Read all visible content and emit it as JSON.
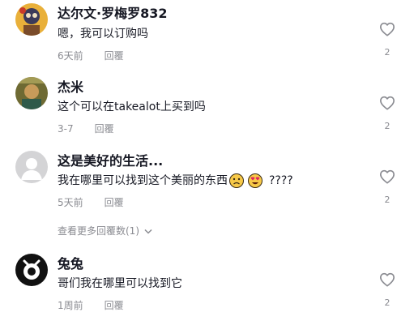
{
  "comments": [
    {
      "author": "达尔文·罗梅罗832",
      "text": "嗯，我可以订购吗",
      "time": "6天前",
      "reply": "回覆",
      "likes": "2"
    },
    {
      "author": "杰米",
      "text": "这个可以在takealot上买到吗",
      "time": "3-7",
      "reply": "回覆",
      "likes": "2"
    },
    {
      "author": "这是美好的生活...",
      "text": "我在哪里可以找到这个美丽的东西",
      "text_suffix": "????",
      "time": "5天前",
      "reply": "回覆",
      "likes": "2"
    },
    {
      "author": "兔兔",
      "text": "哥们我在哪里可以找到它",
      "time": "1周前",
      "reply": "回覆",
      "likes": "2"
    }
  ],
  "view_more": "查看更多回覆数(1)",
  "icons": {
    "like": "heart-outline-icon",
    "expand": "chevron-down-icon",
    "emoji1": "sad-face-emoji",
    "emoji2": "heart-eyes-emoji"
  },
  "colors": {
    "text": "#161823",
    "secondary": "#8a8b91"
  }
}
